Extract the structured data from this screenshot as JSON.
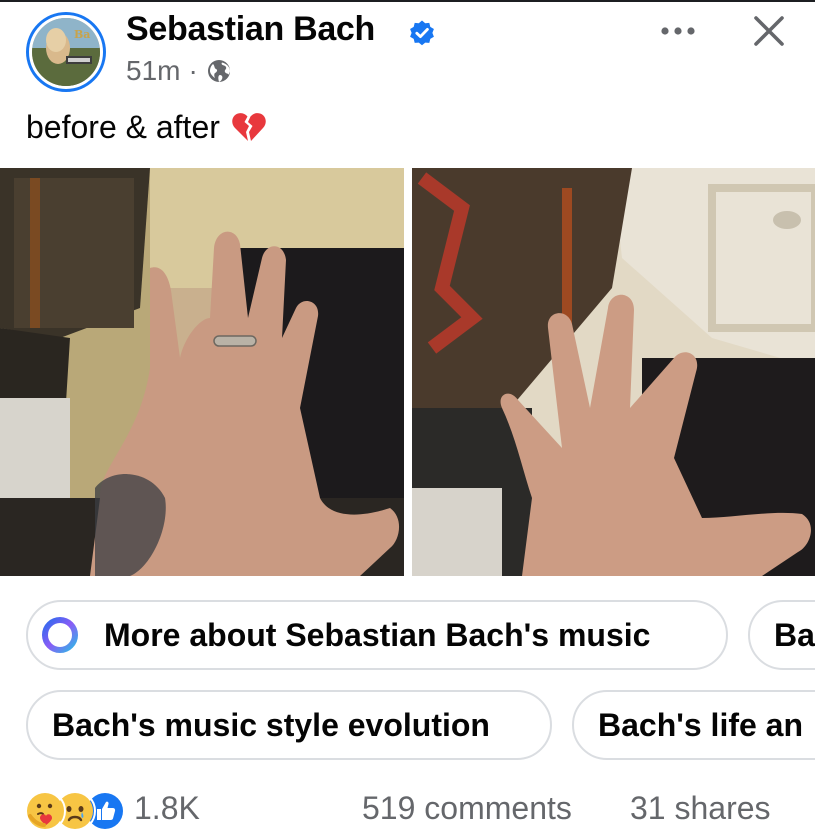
{
  "post": {
    "author_name": "Sebastian Bach",
    "time": "51m",
    "separator": "·",
    "caption": "before & after",
    "photos": [
      {
        "name": "before-photo"
      },
      {
        "name": "after-photo"
      }
    ]
  },
  "suggestions": [
    {
      "label": "More about Sebastian Bach's music"
    },
    {
      "label": "Ba"
    },
    {
      "label": "Bach's music style evolution"
    },
    {
      "label": "Bach's life an"
    }
  ],
  "footer": {
    "reaction_count": "1.8K",
    "comments": "519 comments",
    "shares": "31 shares"
  },
  "icons": {
    "verified": "verified-badge-icon",
    "globe": "globe-icon",
    "more": "more-dots-icon",
    "close": "close-icon",
    "broken_heart": "broken-heart-icon",
    "ai_ring": "ai-ring-icon",
    "reactions": [
      "care-reaction-icon",
      "sad-reaction-icon",
      "like-reaction-icon"
    ]
  },
  "colors": {
    "accent": "#1877f2",
    "secondary_text": "#65676b",
    "chip_border": "#dadde1",
    "broken_heart": "#e8383d"
  }
}
